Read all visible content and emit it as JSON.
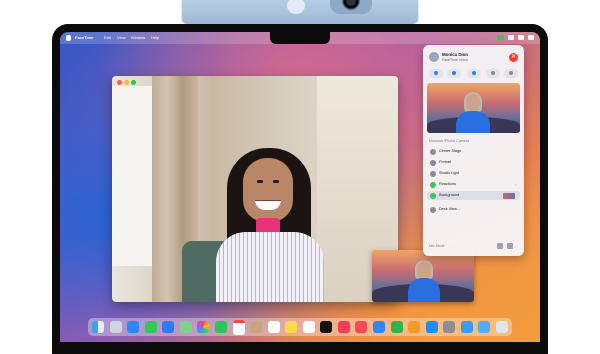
{
  "menubar": {
    "app_name": "FaceTime",
    "menus": [
      "Edit",
      "View",
      "Window",
      "Help"
    ]
  },
  "control_panel": {
    "contact_name": "Monica Dion",
    "call_subtitle": "FaceTime Video",
    "section_title": "Monica's iPhone Camera",
    "options": [
      {
        "label": "Center Stage"
      },
      {
        "label": "Portrait"
      },
      {
        "label": "Studio Light"
      },
      {
        "label": "Reactions"
      },
      {
        "label": "Background"
      },
      {
        "label": "Desk View…"
      }
    ],
    "footer_label": "Mic Mode"
  },
  "colors": {
    "end_call": "#ff3b30",
    "active_green": "#34c759",
    "accent_blue": "#2f7cf6"
  },
  "icons": {
    "menubar": [
      "apple-logo-icon",
      "facetime-status-icon",
      "wifi-icon",
      "battery-icon",
      "control-center-icon"
    ],
    "controls": [
      "microphone-icon",
      "video-camera-icon",
      "mic-mode-icon",
      "screen-share-icon",
      "more-icon"
    ]
  },
  "dock_apps": [
    "Finder",
    "Launchpad",
    "Safari",
    "Messages",
    "Mail",
    "Maps",
    "Photos",
    "FaceTime",
    "Calendar",
    "Contacts",
    "Reminders",
    "Notes",
    "Freeform",
    "TV",
    "Music",
    "News",
    "Keynote",
    "Numbers",
    "Pages",
    "App Store",
    "System Settings",
    "iPhone Mirroring",
    "Downloads",
    "Trash"
  ]
}
